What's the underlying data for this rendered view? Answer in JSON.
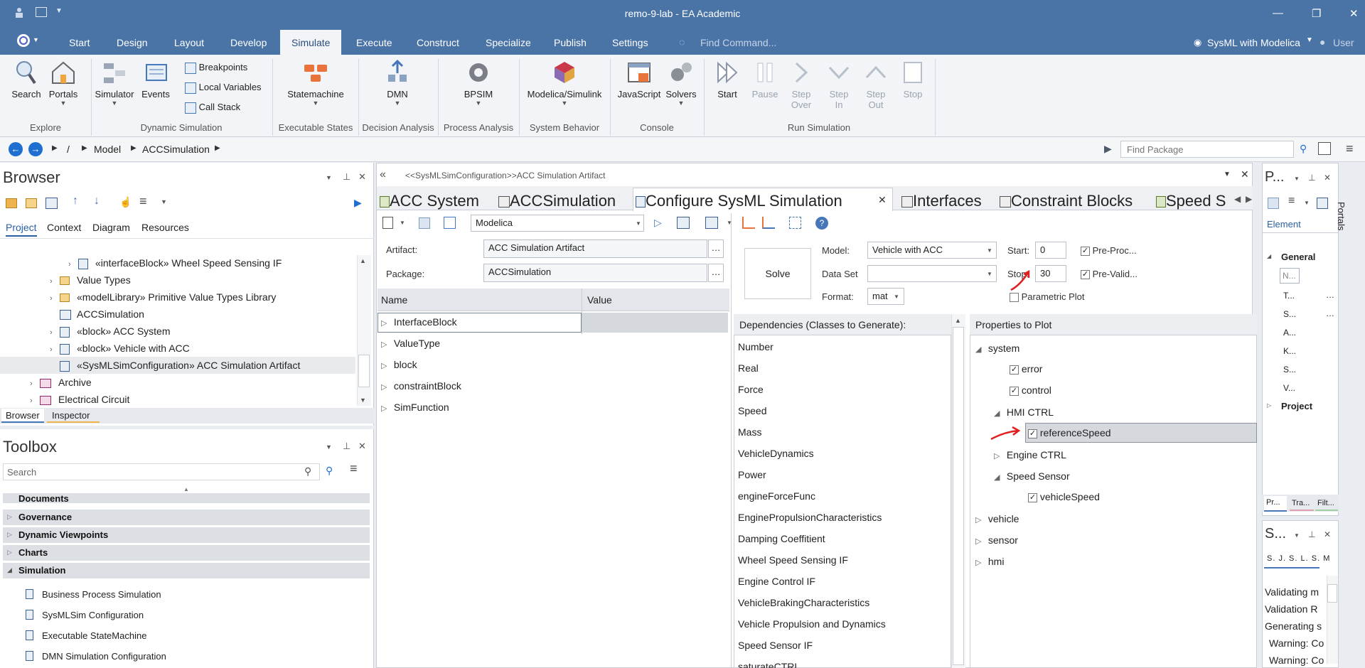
{
  "app": {
    "title": "remo-9-lab - EA Academic"
  },
  "menu": {
    "tabs": [
      "Start",
      "Design",
      "Layout",
      "Develop",
      "Simulate",
      "Execute",
      "Construct",
      "Specialize",
      "Publish",
      "Settings"
    ],
    "active": "Simulate",
    "find_command": "Find Command...",
    "perspective": "SysML with Modelica",
    "user": "User"
  },
  "ribbon": {
    "explore": {
      "group": "Explore",
      "search": "Search",
      "portals": "Portals"
    },
    "dynamic": {
      "group": "Dynamic Simulation",
      "simulator": "Simulator",
      "events": "Events",
      "breakpoints": "Breakpoints",
      "local_variables": "Local Variables",
      "call_stack": "Call Stack"
    },
    "executable": {
      "group": "Executable States",
      "statemachine": "Statemachine"
    },
    "decision": {
      "group": "Decision Analysis",
      "dmn": "DMN"
    },
    "process": {
      "group": "Process Analysis",
      "bpsim": "BPSIM"
    },
    "system": {
      "group": "System Behavior",
      "modelica": "Modelica/Simulink"
    },
    "console": {
      "group": "Console",
      "javascript": "JavaScript",
      "solvers": "Solvers"
    },
    "run": {
      "group": "Run Simulation",
      "start": "Start",
      "pause": "Pause",
      "step_over": "Step Over",
      "step_in": "Step In",
      "step_out": "Step Out",
      "stop": "Stop"
    }
  },
  "address": {
    "crumbs": [
      "/",
      "Model",
      "ACCSimulation"
    ],
    "find_package": "Find Package"
  },
  "browser": {
    "title": "Browser",
    "tabs": [
      "Project",
      "Context",
      "Diagram",
      "Resources"
    ],
    "rows": [
      "«interfaceBlock» Wheel Speed Sensing IF",
      "Value Types",
      "«modelLibrary» Primitive Value Types Library",
      "ACCSimulation",
      "«block» ACC System",
      "«block» Vehicle with ACC",
      "«SysMLSimConfiguration» ACC Simulation Artifact",
      "Archive",
      "Electrical Circuit"
    ],
    "bottom_tabs": [
      "Browser",
      "Inspector"
    ]
  },
  "toolbox": {
    "title": "Toolbox",
    "search_placeholder": "Search",
    "groups": [
      "Documents",
      "Governance",
      "Dynamic Viewpoints",
      "Charts",
      "Simulation"
    ],
    "items": [
      "Business Process Simulation",
      "SysMLSim Configuration",
      "Executable StateMachine",
      "DMN Simulation Configuration"
    ]
  },
  "editor": {
    "breadcrumb": "<<SysMLSimConfiguration>>ACC Simulation Artifact",
    "tabs": [
      "ACC System",
      "ACCSimulation",
      "Configure SysML Simulation",
      "Interfaces",
      "Constraint Blocks",
      "Speed S"
    ],
    "active_tab": "Configure SysML Simulation",
    "platform": "Modelica",
    "artifact_label": "Artifact:",
    "artifact_value": "ACC Simulation Artifact",
    "package_label": "Package:",
    "package_value": "ACCSimulation",
    "grid_headers": [
      "Name",
      "Value"
    ],
    "grid_rows": [
      "InterfaceBlock",
      "ValueType",
      "block",
      "constraintBlock",
      "SimFunction"
    ],
    "solve": "Solve",
    "model_label": "Model:",
    "model_value": "Vehicle with ACC",
    "dataset_label": "Data Set",
    "format_label": "Format:",
    "format_value": "mat",
    "start_label": "Start:",
    "start_value": "0",
    "stop_label": "Stop:",
    "stop_value": "30",
    "preproc": "Pre-Proc...",
    "prevalid": "Pre-Valid...",
    "parametric_plot": "Parametric Plot",
    "deps_title": "Dependencies (Classes to Generate):",
    "deps": [
      "Number",
      "Real",
      "Force",
      "Speed",
      "Mass",
      "VehicleDynamics",
      "Power",
      "engineForceFunc",
      "EnginePropulsionCharacteristics",
      "Damping Coeffitient",
      "Wheel Speed Sensing IF",
      "Engine Control IF",
      "VehicleBrakingCharacteristics",
      "Vehicle Propulsion and Dynamics",
      "Speed Sensor IF",
      "saturateCTRL"
    ],
    "props_title": "Properties to Plot",
    "props": {
      "system": "system",
      "error": "error",
      "control": "control",
      "hmi_ctrl": "HMI CTRL",
      "reference_speed": "referenceSpeed",
      "engine_ctrl": "Engine CTRL",
      "speed_sensor": "Speed Sensor",
      "vehicle_speed": "vehicleSpeed",
      "vehicle": "vehicle",
      "sensor": "sensor",
      "hmi": "hmi"
    }
  },
  "properties": {
    "title": "P...",
    "tab": "Element",
    "general": "General",
    "field_placeholder": "N...",
    "rows": [
      "T...",
      "S...",
      "A...",
      "K...",
      "S...",
      "V..."
    ],
    "project": "Project",
    "bottom_tabs": [
      "Pr...",
      "Tra...",
      "Filt..."
    ]
  },
  "portals": "Portals",
  "sim_panel": {
    "title": "S...",
    "tabs": "S. J. S. L. S. M",
    "lines": [
      "Validating m",
      "Validation R",
      "Generating s",
      "Warning: Co",
      "Warning: Co"
    ]
  }
}
